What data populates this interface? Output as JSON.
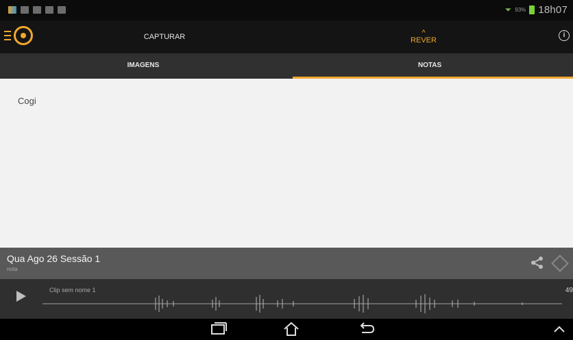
{
  "status_bar": {
    "notification_icons": [
      "app-icon",
      "image-icon",
      "gallery-icon",
      "mail-icon",
      "sync-icon"
    ],
    "battery_percent": "93%",
    "time": "18h07"
  },
  "app_bar": {
    "capture_tab": "CAPTURAR",
    "review_tab": "REVER",
    "review_chevron": "^",
    "info_icon": "i",
    "accent_color": "#f2a72f"
  },
  "sub_tabs": {
    "images": "IMAGENS",
    "notes": "NOTAS"
  },
  "notes_content": {
    "text": "Cogi"
  },
  "session": {
    "title": "Qua Ago 26 Sessão 1",
    "subtitle": "nota"
  },
  "player": {
    "clip_name": "Clip sem nome 1",
    "duration": "49"
  }
}
